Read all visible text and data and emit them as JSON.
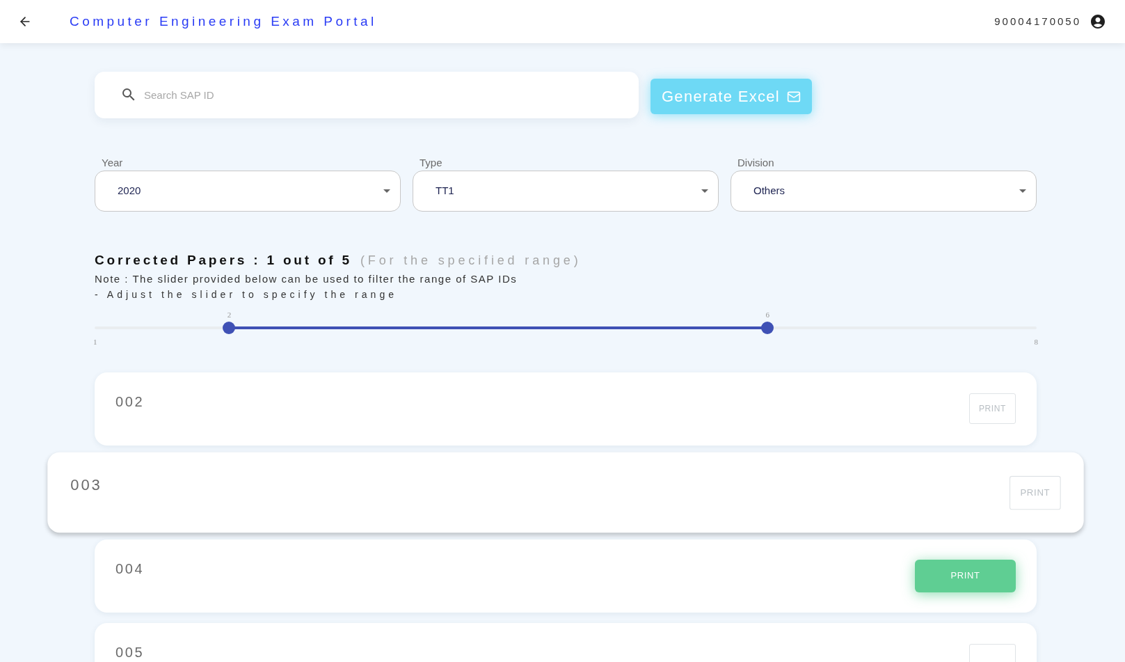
{
  "header": {
    "title": "Computer Engineering Exam Portal",
    "user_id": "90004170050"
  },
  "search": {
    "placeholder": "Search SAP ID"
  },
  "generate_button": {
    "label": "Generate Excel"
  },
  "filters": [
    {
      "label": "Year",
      "value": "2020"
    },
    {
      "label": "Type",
      "value": "TT1"
    },
    {
      "label": "Division",
      "value": "Others"
    }
  ],
  "summary": {
    "title": "Corrected Papers : 1 out of 5",
    "subtitle": "(For the specified range)",
    "note": "Note : The slider provided below can be used to filter the range of SAP IDs",
    "hint": "- Adjust the slider to specify the range"
  },
  "slider": {
    "min_label": "1",
    "max_label": "8",
    "thumbs": [
      {
        "label": "2",
        "level": 0.1429
      },
      {
        "label": "6",
        "level": 0.7143
      }
    ]
  },
  "papers": [
    {
      "id": "002",
      "raised": false,
      "print": {
        "label": "PRINT",
        "disabled": true
      }
    },
    {
      "id": "003",
      "raised": true,
      "print": {
        "label": "PRINT",
        "disabled": true
      }
    },
    {
      "id": "004",
      "raised": false,
      "print": {
        "label": "PRINT",
        "disabled": false
      }
    },
    {
      "id": "005",
      "raised": false,
      "print": {
        "disabled": true
      }
    }
  ]
}
